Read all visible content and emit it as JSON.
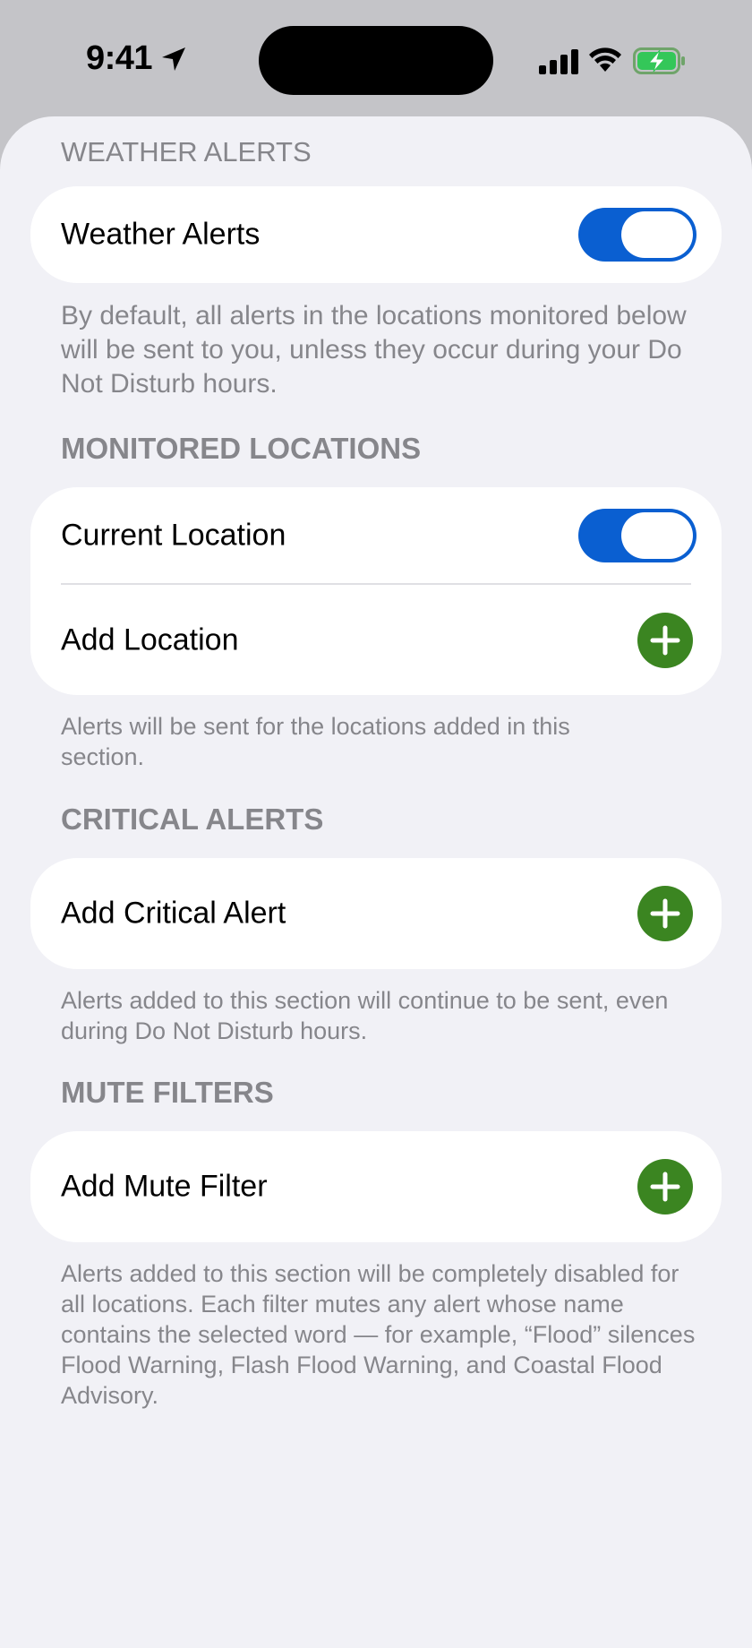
{
  "status_bar": {
    "time": "9:41"
  },
  "sections": {
    "weather_alerts": {
      "header": "WEATHER ALERTS",
      "toggle_label": "Weather Alerts",
      "toggle_on": true,
      "footer": "By default, all alerts in the locations monitored below will be sent to you, unless they occur during your Do Not Disturb hours."
    },
    "monitored_locations": {
      "header": "MONITORED LOCATIONS",
      "current_location_label": "Current Location",
      "current_location_on": true,
      "add_location_label": "Add Location",
      "footer": "Alerts will be sent for the locations added in this section."
    },
    "critical_alerts": {
      "header": "CRITICAL ALERTS",
      "add_label": "Add Critical Alert",
      "footer": "Alerts added to this section will continue to be sent, even during Do Not Disturb hours."
    },
    "mute_filters": {
      "header": "MUTE FILTERS",
      "add_label": "Add Mute Filter",
      "footer": "Alerts added to this section will be completely disabled for all locations. Each filter mutes any alert whose name contains the selected word — for example, “Flood” silences Flood Warning, Flash Flood Warning, and Coastal Flood Advisory."
    }
  },
  "colors": {
    "toggle_on": "#0a5fd1",
    "add_button": "#3b8521",
    "battery_fill": "#34c759"
  },
  "icons": {
    "location": "location-arrow-icon",
    "signal": "cellular-signal-icon",
    "wifi": "wifi-icon",
    "battery": "battery-charging-icon",
    "add": "plus-icon"
  }
}
